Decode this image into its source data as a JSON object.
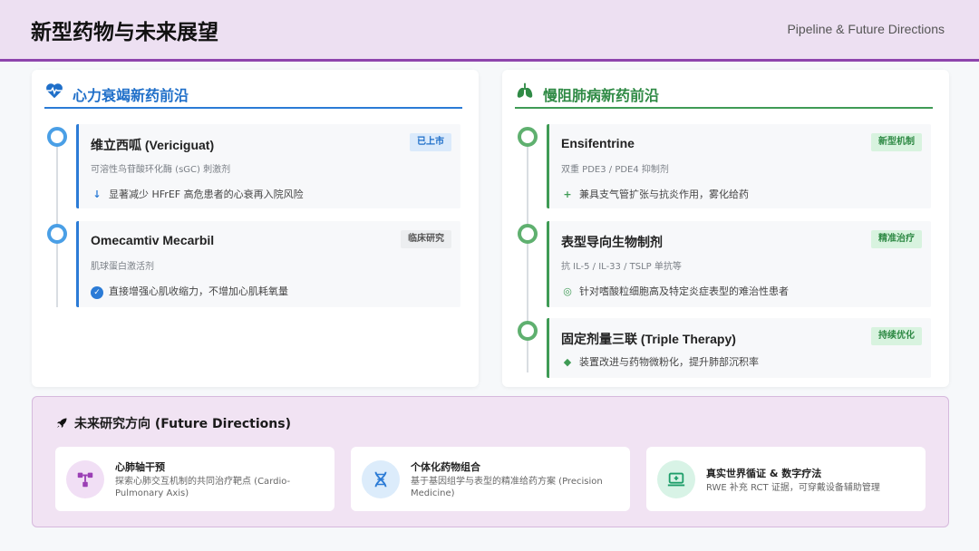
{
  "header": {
    "title": "新型药物与未来展望",
    "subtitle": "Pipeline & Future Directions"
  },
  "left_panel": {
    "title": "心力衰竭新药前沿",
    "icon": "heartbeat-icon",
    "accent": "#2b7bd6",
    "items": [
      {
        "name": "维立西呱 (Vericiguat)",
        "desc": "可溶性鸟苷酸环化酶 (sGC) 刺激剂",
        "badge": "已上市",
        "note": "显著减少 HFrEF 高危患者的心衰再入院风险",
        "note_icon": "arrow-down-icon"
      },
      {
        "name": "Omecamtiv Mecarbil",
        "desc": "肌球蛋白激活剂",
        "badge": "临床研究",
        "note": "直接增强心肌收缩力，不增加心肌耗氧量",
        "note_icon": "check-circle-icon"
      }
    ]
  },
  "right_panel": {
    "title": "慢阻肺病新药前沿",
    "icon": "lungs-icon",
    "accent": "#3f9b55",
    "items": [
      {
        "name": "Ensifentrine",
        "desc": "双重 PDE3 / PDE4 抑制剂",
        "badge": "新型机制",
        "note": "兼具支气管扩张与抗炎作用，雾化给药",
        "note_icon": "plus-icon"
      },
      {
        "name": "表型导向生物制剂",
        "desc": "抗 IL-5 / IL-33 / TSLP 单抗等",
        "badge": "精准治疗",
        "note": "针对嗜酸粒细胞高及特定炎症表型的难治性患者",
        "note_icon": "target-icon"
      },
      {
        "name": "固定剂量三联 (Triple Therapy)",
        "desc": "",
        "badge": "持续优化",
        "note": "装置改进与药物微粉化，提升肺部沉积率",
        "note_icon": "layers-icon"
      }
    ]
  },
  "future": {
    "title": "未来研究方向 (Future Directions)",
    "icon": "rocket-icon",
    "items": [
      {
        "name": "心肺轴干预",
        "desc": "探索心肺交互机制的共同治疗靶点 (Cardio-Pulmonary Axis)",
        "icon": "network-icon"
      },
      {
        "name": "个体化药物组合",
        "desc": "基于基因组学与表型的精准给药方案 (Precision Medicine)",
        "icon": "dna-icon"
      },
      {
        "name": "真实世界循证 & 数字疗法",
        "desc": "RWE 补充 RCT 证据，可穿戴设备辅助管理",
        "icon": "laptop-medical-icon"
      }
    ]
  }
}
